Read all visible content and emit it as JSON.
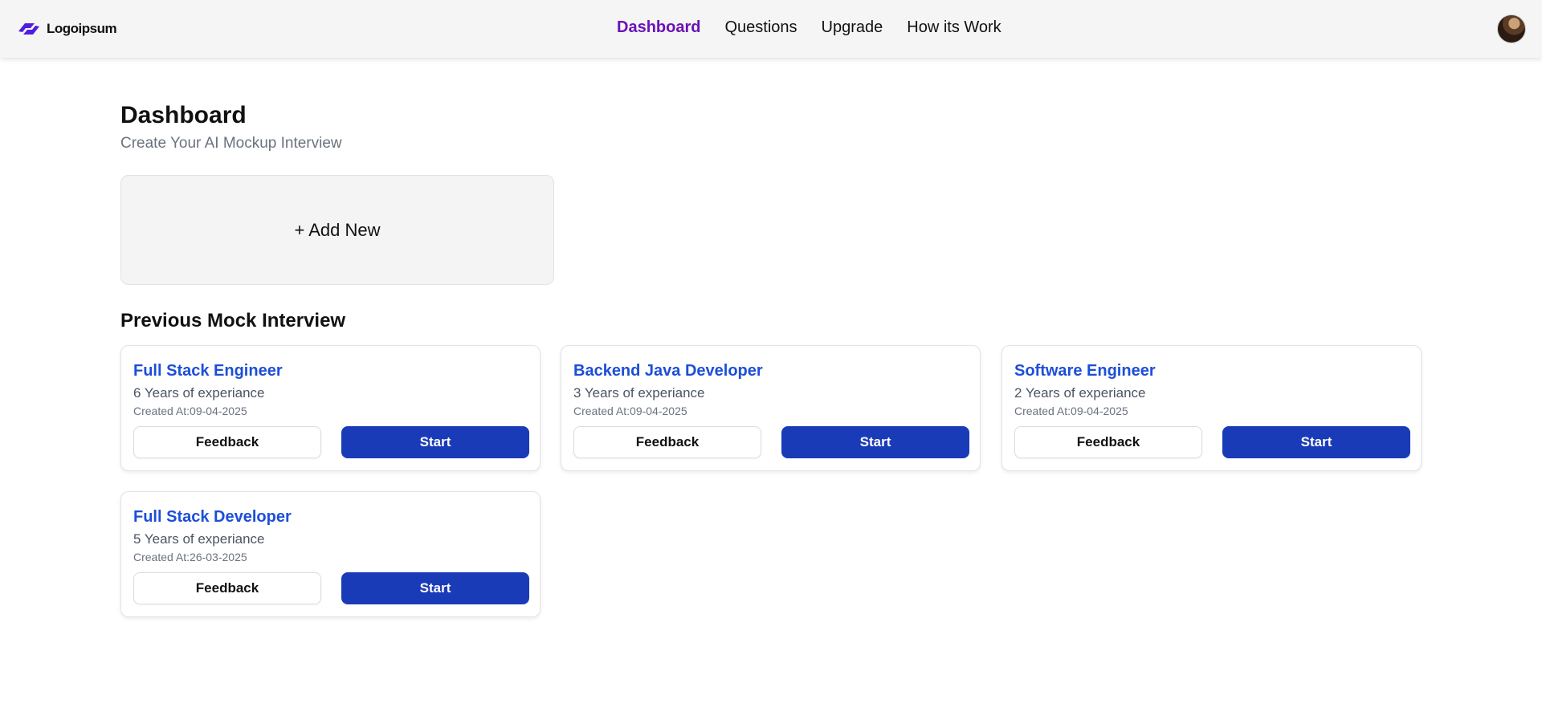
{
  "colors": {
    "accent_nav": "#6b12b8",
    "card_title": "#1d4ed8",
    "start_button": "#1a3bb8",
    "navbar_bg": "#f5f5f5",
    "logo_mark": "#4f1ee0"
  },
  "navbar": {
    "logo_text": "Logoipsum",
    "links": [
      {
        "label": "Dashboard",
        "active": true
      },
      {
        "label": "Questions",
        "active": false
      },
      {
        "label": "Upgrade",
        "active": false
      },
      {
        "label": "How its Work",
        "active": false
      }
    ],
    "avatar_icon": "user-avatar"
  },
  "main": {
    "title": "Dashboard",
    "subtitle": "Create Your AI Mockup Interview",
    "add_new_label": "+ Add New",
    "section_title": "Previous Mock Interview"
  },
  "interviews": [
    {
      "title": "Full Stack Engineer",
      "experience": "6 Years of experiance",
      "created": "Created At:09-04-2025",
      "feedback_label": "Feedback",
      "start_label": "Start"
    },
    {
      "title": "Backend Java Developer",
      "experience": "3 Years of experiance",
      "created": "Created At:09-04-2025",
      "feedback_label": "Feedback",
      "start_label": "Start"
    },
    {
      "title": "Software Engineer",
      "experience": "2 Years of experiance",
      "created": "Created At:09-04-2025",
      "feedback_label": "Feedback",
      "start_label": "Start"
    },
    {
      "title": "Full Stack Developer",
      "experience": "5 Years of experiance",
      "created": "Created At:26-03-2025",
      "feedback_label": "Feedback",
      "start_label": "Start"
    }
  ]
}
